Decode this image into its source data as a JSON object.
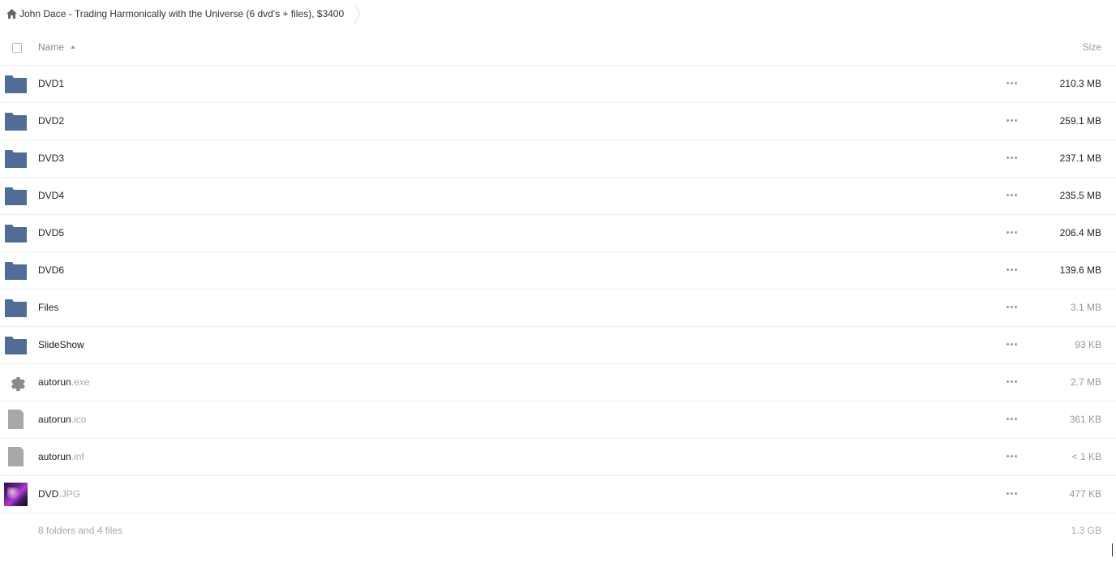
{
  "breadcrumb": {
    "label": "John Dace - Trading Harmonically with the Universe (6 dvd's + files), $3400"
  },
  "header": {
    "name_label": "Name",
    "size_label": "Size"
  },
  "rows": [
    {
      "name": "DVD1",
      "ext": "",
      "size": "210.3 MB",
      "type": "folder"
    },
    {
      "name": "DVD2",
      "ext": "",
      "size": "259.1 MB",
      "type": "folder"
    },
    {
      "name": "DVD3",
      "ext": "",
      "size": "237.1 MB",
      "type": "folder"
    },
    {
      "name": "DVD4",
      "ext": "",
      "size": "235.5 MB",
      "type": "folder"
    },
    {
      "name": "DVD5",
      "ext": "",
      "size": "206.4 MB",
      "type": "folder"
    },
    {
      "name": "DVD6",
      "ext": "",
      "size": "139.6 MB",
      "type": "folder"
    },
    {
      "name": "Files",
      "ext": "",
      "size": "3.1 MB",
      "type": "folder"
    },
    {
      "name": "SlideShow",
      "ext": "",
      "size": "93 KB",
      "type": "folder"
    },
    {
      "name": "autorun",
      "ext": ".exe",
      "size": "2.7 MB",
      "type": "exe"
    },
    {
      "name": "autorun",
      "ext": ".ico",
      "size": "361 KB",
      "type": "file"
    },
    {
      "name": "autorun",
      "ext": ".inf",
      "size": "< 1 KB",
      "type": "file"
    },
    {
      "name": "DVD",
      "ext": ".JPG",
      "size": "477 KB",
      "type": "image"
    }
  ],
  "summary": {
    "count": "8 folders and 4 files",
    "total": "1.3 GB"
  },
  "colors": {
    "folder": "#4f6d96",
    "file": "#a8a8a8"
  },
  "icons": {
    "folder": "folder-icon",
    "exe": "gear-icon",
    "file": "file-icon",
    "image": "image-thumbnail"
  }
}
